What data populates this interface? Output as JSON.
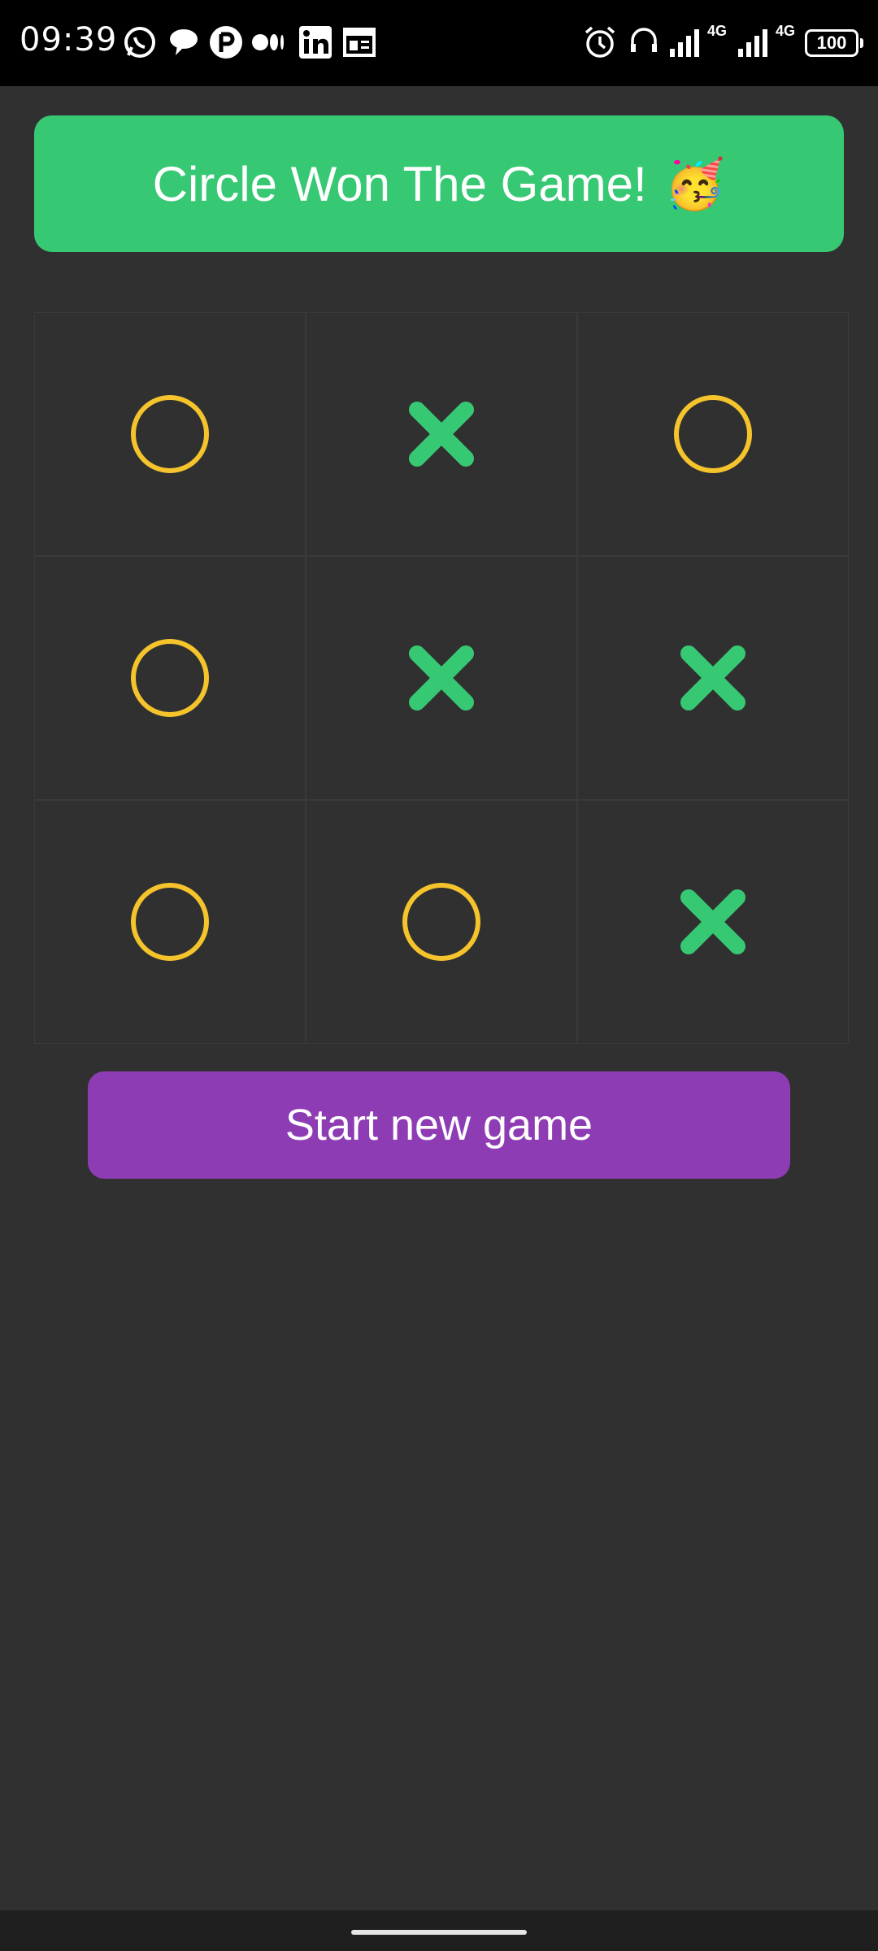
{
  "status_bar": {
    "time": "09:39",
    "battery": "100",
    "network_label_1": "4G",
    "network_label_2": "4G",
    "left_icons": [
      "whatsapp-icon",
      "chat-bubble-icon",
      "app-p-icon",
      "medium-icon",
      "linkedin-icon",
      "news-icon"
    ],
    "right_icons": [
      "alarm-icon",
      "headset-icon",
      "signal-icon",
      "signal-icon"
    ]
  },
  "banner": {
    "text": "Circle Won The Game!",
    "emoji": "🥳",
    "color": "#37c874"
  },
  "board": {
    "cells": [
      "O",
      "X",
      "O",
      "O",
      "X",
      "X",
      "O",
      "O",
      "X"
    ],
    "circle_color": "#f5c42c",
    "cross_color": "#37c874"
  },
  "actions": {
    "new_game_label": "Start new game",
    "new_game_color": "#8e3cb3"
  }
}
